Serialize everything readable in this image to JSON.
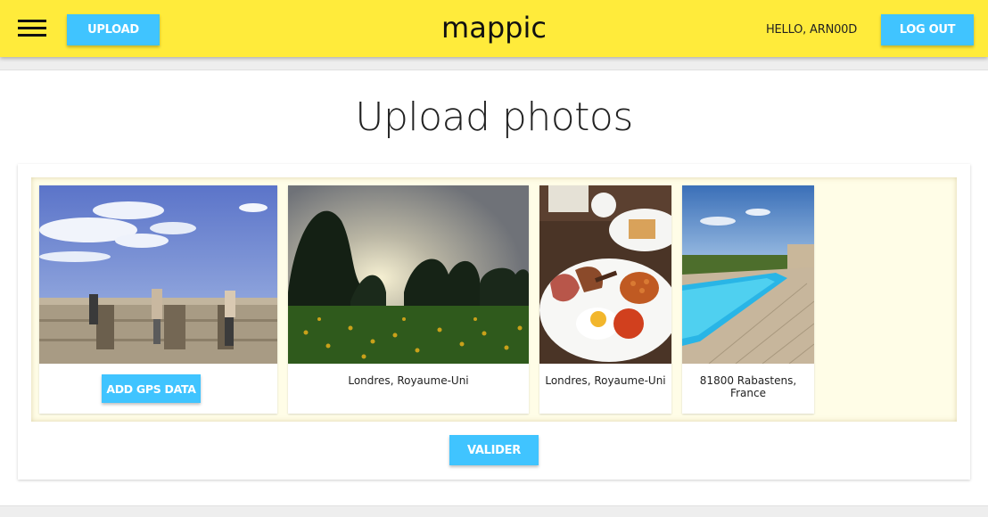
{
  "header": {
    "upload_label": "UPLOAD",
    "brand": "mappic",
    "greeting": "HELLO, ARN00D",
    "logout_label": "LOG OUT"
  },
  "main": {
    "title": "Upload photos",
    "photos": [
      {
        "location": null,
        "action_label": "ADD GPS DATA"
      },
      {
        "location": "Londres, Royaume-Uni"
      },
      {
        "location": "Londres, Royaume-Uni"
      },
      {
        "location": "81800 Rabastens, France"
      }
    ],
    "submit_label": "VALIDER"
  },
  "colors": {
    "header_bg": "#ffeb3b",
    "button": "#40c4ff",
    "dropzone": "#fffde7"
  }
}
